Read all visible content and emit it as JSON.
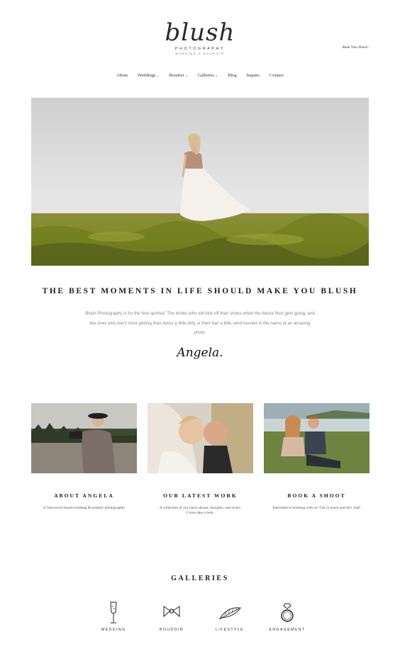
{
  "brand": {
    "logo_script": "blush",
    "logo_sub": "PHOTOGRAPHY",
    "logo_sub2": "WEDDING & BOUDOIR"
  },
  "header": {
    "book_cta": "Book Your Shoot+"
  },
  "nav": {
    "items": [
      {
        "label": "About"
      },
      {
        "label": "Weddings"
      },
      {
        "label": "Boudoir"
      },
      {
        "label": "Galleries"
      },
      {
        "label": "Blog"
      },
      {
        "label": "Inquire"
      },
      {
        "label": "Contact"
      }
    ]
  },
  "hero": {
    "alt": ""
  },
  "intro": {
    "headline": "THE BEST MOMENTS IN LIFE SHOULD MAKE YOU BLUSH",
    "body": "Blush Photography is for the free spirited. The brides who will kick off their shoes when the dance floor gets going, and the ones who don't mind getting their dress a little dirty or their hair a little wind tousled in the name of an amazing photo.",
    "signature": "Angela."
  },
  "cards": [
    {
      "title": "ABOUT ANGELA",
      "text": "A Vancouver-based wedding & boudoir photographer"
    },
    {
      "title": "OUR LATEST WORK",
      "text": "A collection of our latest shoots, thoughts, and styles.",
      "text2": "Come take a look."
    },
    {
      "title": "BOOK A SHOOT",
      "text": "Interested in booking with us? Get in touch and let's chat!"
    }
  ],
  "galleries": {
    "title": "GALLERIES",
    "items": [
      {
        "label": "WEDDING",
        "icon": "champagne-glass-icon"
      },
      {
        "label": "BOUDOIR",
        "icon": "bow-tie-icon"
      },
      {
        "label": "LIFESTYLE",
        "icon": "feather-icon"
      },
      {
        "label": "ENGAGEMENT",
        "icon": "diamond-ring-icon"
      }
    ]
  },
  "colors": {
    "text": "#1e1e1e",
    "muted": "#8a8a8a",
    "moss": "#7a8a2a",
    "sky": "#dcdcdc"
  }
}
